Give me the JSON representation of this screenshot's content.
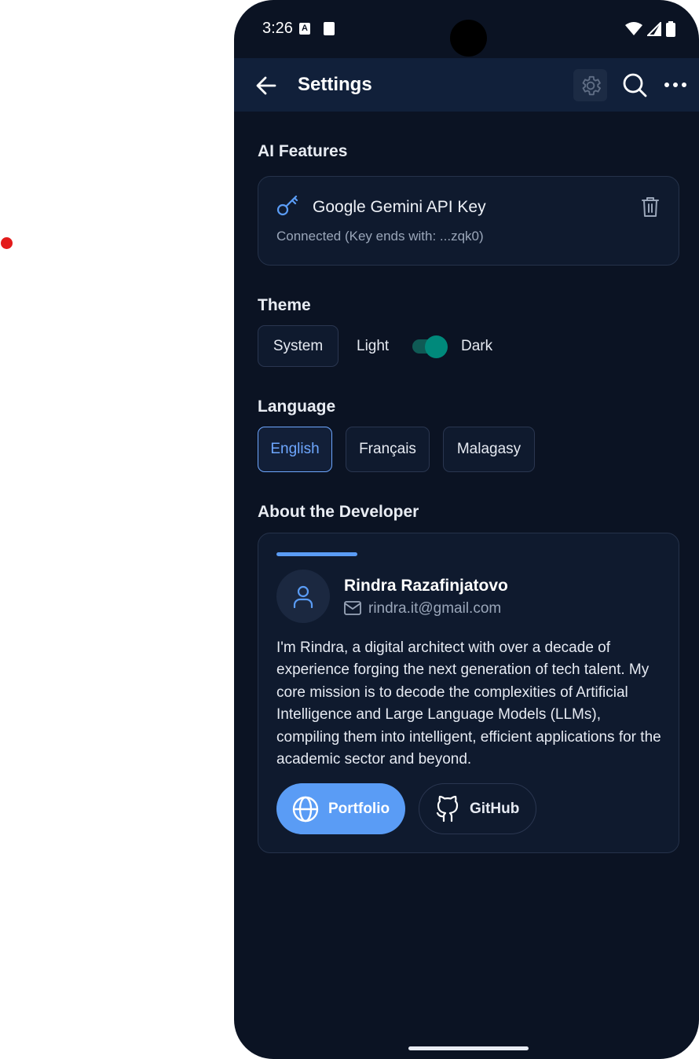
{
  "status_bar": {
    "time": "3:26",
    "notification_a": "A"
  },
  "app_bar": {
    "title": "Settings",
    "icons": [
      "back-arrow-icon",
      "gear-icon",
      "search-icon",
      "more-icon"
    ]
  },
  "ai_features": {
    "section_title": "AI Features",
    "api_key_title": "Google Gemini API Key",
    "api_key_status": "Connected (Key ends with: ...zqk0)"
  },
  "theme": {
    "section_title": "Theme",
    "system_label": "System",
    "light_label": "Light",
    "dark_label": "Dark",
    "dark_enabled": true,
    "toggle_color": "#00897b"
  },
  "language": {
    "section_title": "Language",
    "options": [
      "English",
      "Français",
      "Malagasy"
    ],
    "selected": "English"
  },
  "developer": {
    "section_title": "About the Developer",
    "name": "Rindra Razafinjatovo",
    "email": "rindra.it@gmail.com",
    "bio": "I'm Rindra, a digital architect with over a decade of experience forging the next generation of tech talent. My core mission is to decode the complexities of Artificial Intelligence and Large Language Models (LLMs), compiling them into intelligent, efficient applications for the academic sector and beyond.",
    "portfolio_label": "Portfolio",
    "github_label": "GitHub"
  },
  "colors": {
    "accent": "#5a9cf5",
    "background": "#0b1323",
    "app_bar": "#11203a"
  }
}
